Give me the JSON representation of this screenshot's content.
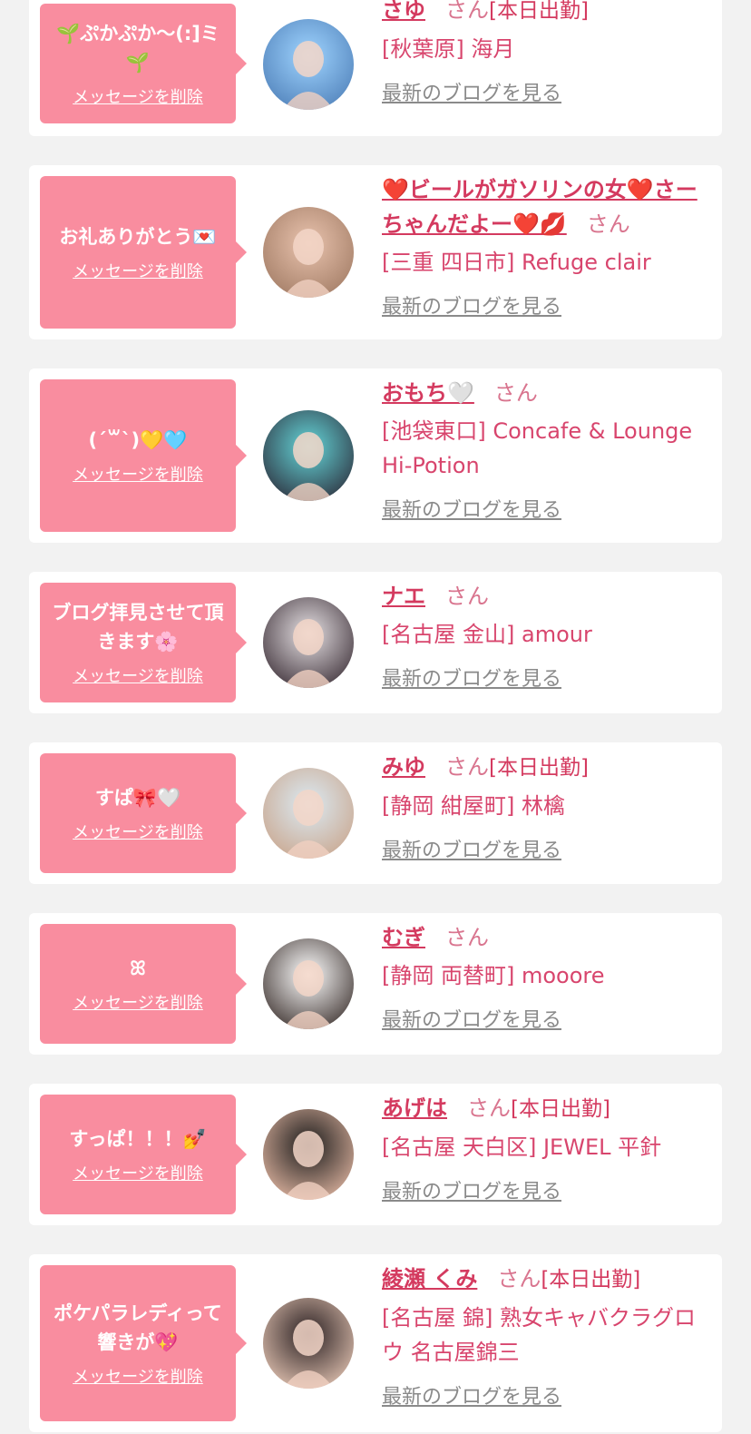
{
  "messages": [
    {
      "message": "🌱ぷかぷか〜(:]ミ🌱",
      "delete_label": "メッセージを削除",
      "name": "さゆ",
      "honorific": "さん",
      "badge": "[本日出勤]",
      "shop": "[秋葉原] 海月",
      "blog_label": "最新のブログを見る",
      "avatar_colors": [
        "#9fd4ff",
        "#4e7fb8"
      ]
    },
    {
      "message": "お礼ありがとう💌",
      "delete_label": "メッセージを削除",
      "name": "❤️ビールがガソリンの女❤️さーちゃんだよー❤️💋",
      "honorific": "さん",
      "badge": "",
      "shop": "[三重 四日市] Refuge clair",
      "blog_label": "最新のブログを見る",
      "avatar_colors": [
        "#e9c3ae",
        "#a07a63"
      ]
    },
    {
      "message": "(ˊ꒳ˋ)💛🩵",
      "delete_label": "メッセージを削除",
      "name": "おもち🤍",
      "honorific": "さん",
      "badge": "",
      "shop": "[池袋東口] Concafe & Lounge Hi-Potion",
      "blog_label": "最新のブログを見る",
      "avatar_colors": [
        "#64d6d9",
        "#2c2c3a"
      ]
    },
    {
      "message": "ブログ拝見させて頂きます🌸",
      "delete_label": "メッセージを削除",
      "name": "ナエ",
      "honorific": "さん",
      "badge": "",
      "shop": "[名古屋 金山] amour",
      "blog_label": "最新のブログを見る",
      "avatar_colors": [
        "#e6e1e4",
        "#3b2e36"
      ]
    },
    {
      "message": "すぱ🎀🤍",
      "delete_label": "メッセージを削除",
      "name": "みゆ",
      "honorific": "さん",
      "badge": "[本日出勤]",
      "shop": "[静岡 紺屋町] 林檎",
      "blog_label": "最新のブログを見る",
      "avatar_colors": [
        "#dbeaf3",
        "#c9a58c"
      ]
    },
    {
      "message": "ꕤ",
      "delete_label": "メッセージを削除",
      "name": "むぎ",
      "honorific": "さん",
      "badge": "",
      "shop": "[静岡 両替町] mooore",
      "blog_label": "最新のブログを見る",
      "avatar_colors": [
        "#ffffff",
        "#3a2f2c"
      ]
    },
    {
      "message": "すっぱ！！！💅",
      "delete_label": "メッセージを削除",
      "name": "あげは",
      "honorific": "さん",
      "badge": "[本日出勤]",
      "shop": "[名古屋 天白区] JEWEL 平針",
      "blog_label": "最新のブログを見る",
      "avatar_colors": [
        "#1b1b1b",
        "#e5b9a4"
      ]
    },
    {
      "message": "ポケパラレディって響きが💖",
      "delete_label": "メッセージを削除",
      "name": "綾瀬 くみ",
      "honorific": "さん",
      "badge": "[本日出勤]",
      "shop": "[名古屋 錦] 熟女キャバクラグロウ 名古屋錦三",
      "blog_label": "最新のブログを見る",
      "avatar_colors": [
        "#2a2022",
        "#e8c8b6"
      ]
    }
  ],
  "colors": {
    "bubble": "#f98d9f",
    "name": "#d43a5f",
    "shop": "#d8456d",
    "link_gray": "#8a8a8a",
    "page_bg": "#f2f2f2"
  }
}
